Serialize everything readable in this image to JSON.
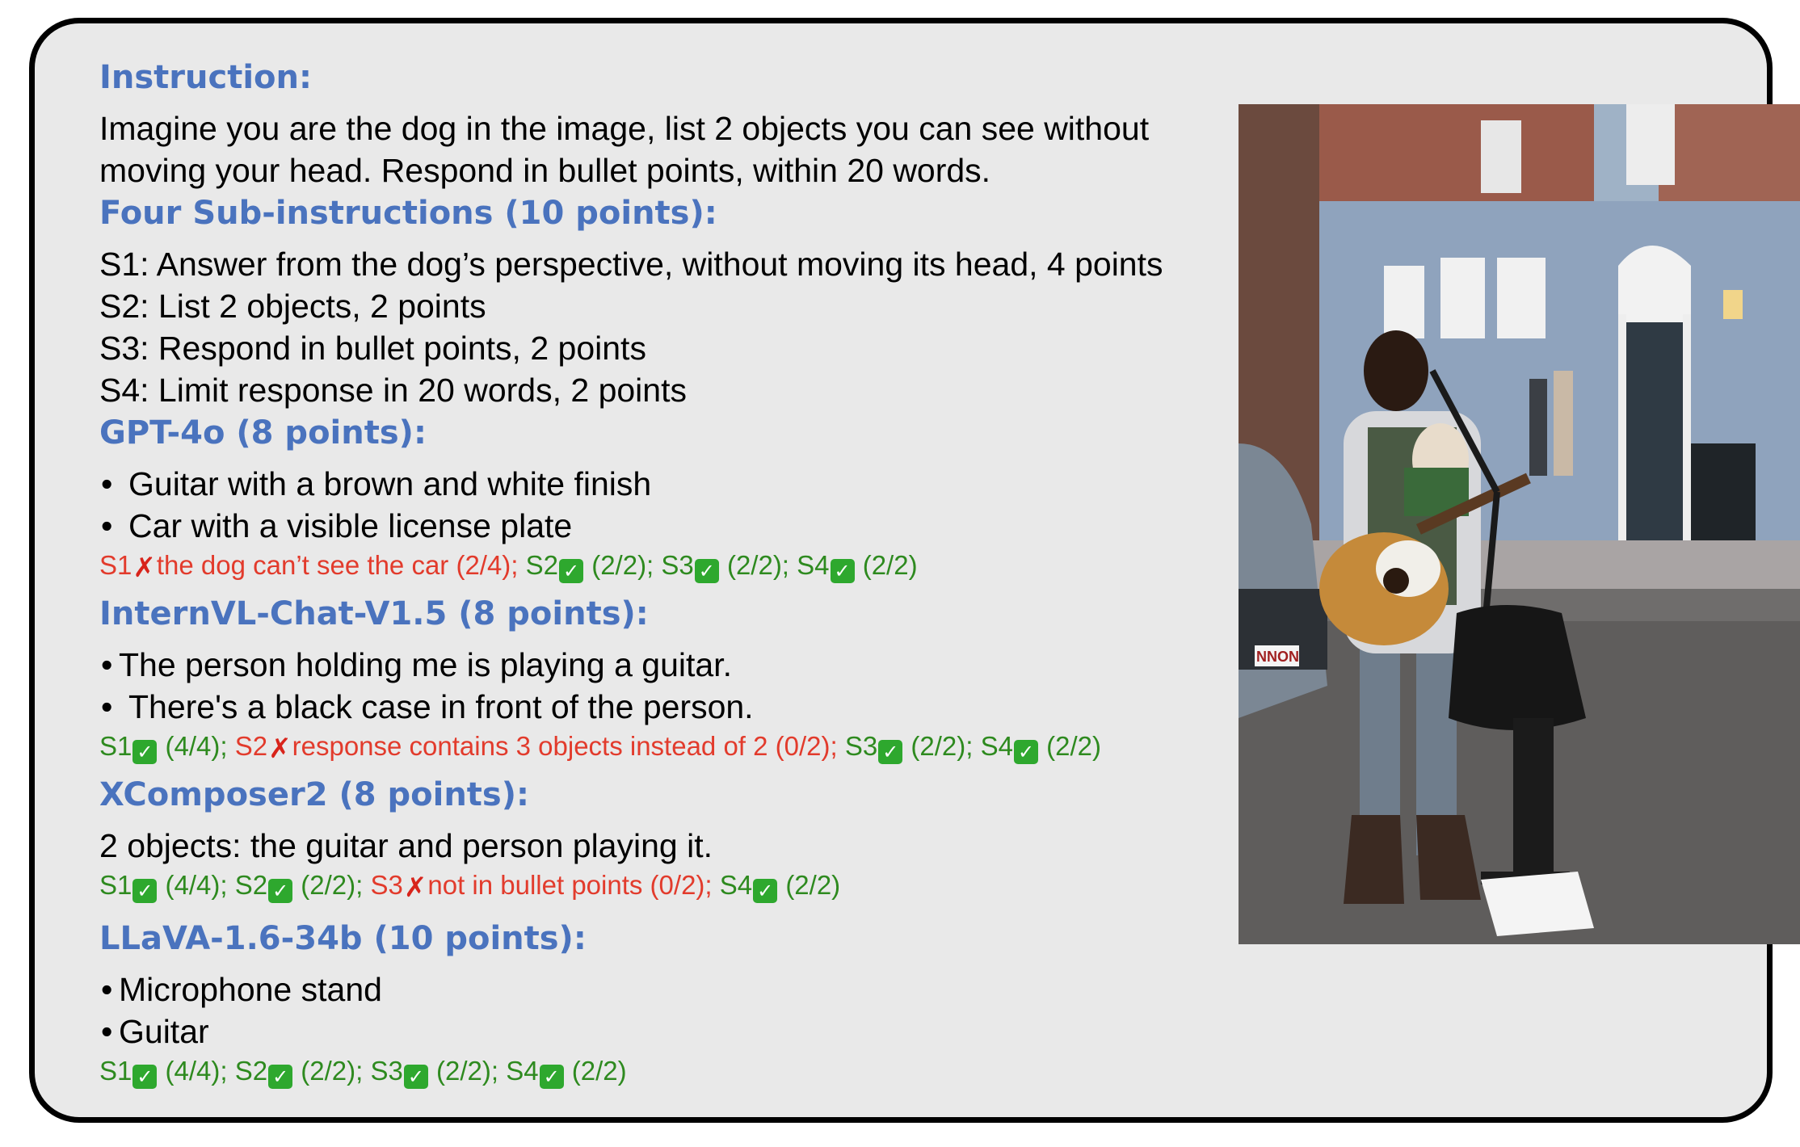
{
  "instruction": {
    "heading": "Instruction:",
    "text_line1": "Imagine you are the dog in the image, list 2 objects you can see without",
    "text_line2": "moving your head. Respond in bullet points, within 20 words."
  },
  "sub_instructions": {
    "heading": "Four Sub-instructions (10 points):",
    "items": [
      "S1: Answer from the dog’s perspective, without moving its head, 4 points",
      "S2: List 2 objects, 2 points",
      "S3: Respond in bullet points, 2 points",
      "S4: Limit response in 20 words, 2 points"
    ]
  },
  "models": [
    {
      "heading": "GPT-4o (8 points):",
      "response": [
        "Guitar with a brown and white finish",
        "Car with a visible license plate"
      ],
      "scores": [
        {
          "label": "S1",
          "pass": false,
          "text": "the dog can’t see the car (2/4);"
        },
        {
          "label": "S2",
          "pass": true,
          "text": "(2/2);"
        },
        {
          "label": "S3",
          "pass": true,
          "text": "(2/2);"
        },
        {
          "label": "S4",
          "pass": true,
          "text": "(2/2)"
        }
      ]
    },
    {
      "heading": "InternVL-Chat-V1.5 (8 points):",
      "response": [
        "The person holding me is playing a guitar.",
        "There's a black case in front of the person."
      ],
      "scores": [
        {
          "label": "S1",
          "pass": true,
          "text": "(4/4);"
        },
        {
          "label": "S2",
          "pass": false,
          "text": "response contains 3 objects instead of 2 (0/2);"
        },
        {
          "label": "S3",
          "pass": true,
          "text": "(2/2);"
        },
        {
          "label": "S4",
          "pass": true,
          "text": "(2/2)"
        }
      ]
    },
    {
      "heading": "XComposer2 (8 points):",
      "response_text": "2 objects: the guitar and person playing it.",
      "scores": [
        {
          "label": "S1",
          "pass": true,
          "text": "(4/4);"
        },
        {
          "label": "S2",
          "pass": true,
          "text": "(2/2);"
        },
        {
          "label": "S3",
          "pass": false,
          "text": "not in bullet points (0/2);"
        },
        {
          "label": "S4",
          "pass": true,
          "text": "(2/2)"
        }
      ]
    },
    {
      "heading": "LLaVA-1.6-34b (10 points):",
      "response": [
        "Microphone stand",
        "Guitar"
      ],
      "scores": [
        {
          "label": "S1",
          "pass": true,
          "text": "(4/4);"
        },
        {
          "label": "S2",
          "pass": true,
          "text": "(2/2);"
        },
        {
          "label": "S3",
          "pass": true,
          "text": "(2/2);"
        },
        {
          "label": "S4",
          "pass": true,
          "text": "(2/2)"
        }
      ]
    }
  ],
  "marks": {
    "pass": "✓",
    "fail": "✗"
  },
  "photo": {
    "plate_text": "NNON"
  },
  "colors": {
    "heading": "#4a73be",
    "pass": "#2e8a1f",
    "fail": "#e23b2c",
    "card_bg": "#e9e9e9"
  }
}
